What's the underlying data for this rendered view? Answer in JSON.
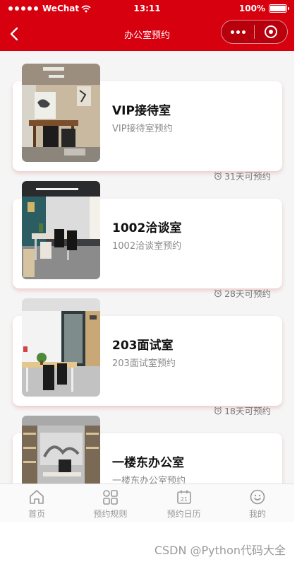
{
  "status_bar": {
    "carrier": "WeChat",
    "time": "13:11",
    "battery": "100%"
  },
  "nav": {
    "title": "办公室预约"
  },
  "rooms": [
    {
      "name": "VIP接待室",
      "description": "VIP接待室预约",
      "availability": "31天可预约",
      "thumbnail": "office-photo-vip"
    },
    {
      "name": "1002洽谈室",
      "description": "1002洽谈室预约",
      "availability": "28天可预约",
      "thumbnail": "office-photo-1002"
    },
    {
      "name": "203面试室",
      "description": "203面试室预约",
      "availability": "18天可预约",
      "thumbnail": "office-photo-203"
    },
    {
      "name": "一楼东办公室",
      "description": "一楼东办公室预约",
      "availability": "",
      "thumbnail": "office-photo-east"
    }
  ],
  "tabbar": {
    "items": [
      {
        "label": "首页",
        "icon": "home-icon"
      },
      {
        "label": "预约规则",
        "icon": "grid-icon"
      },
      {
        "label": "预约日历",
        "icon": "calendar-icon"
      },
      {
        "label": "我的",
        "icon": "smile-icon"
      }
    ]
  },
  "watermark": "CSDN @Python代码大全",
  "colors": {
    "brand_red": "#d7000f",
    "background": "#f5f5f5",
    "card": "#ffffff",
    "muted_text": "#8a8a8a"
  }
}
